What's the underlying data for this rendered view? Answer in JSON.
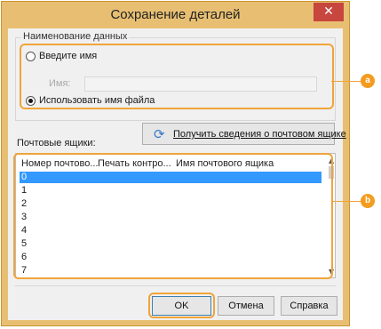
{
  "window": {
    "title": "Сохранение деталей",
    "close_glyph": "✕"
  },
  "data_name_group": {
    "title": "Наименование данных",
    "option_enter_name": "Введите имя",
    "name_label": "Имя:",
    "name_value": "",
    "option_use_filename": "Использовать имя файла",
    "selected_option": "use_filename"
  },
  "mailboxes": {
    "label": "Почтовые ящики:",
    "get_info_button": "Получить сведения о почтовом ящике",
    "columns": [
      "Номер почтово...",
      "Печать контро...",
      "Имя почтового ящика"
    ],
    "rows": [
      "0",
      "1",
      "2",
      "3",
      "4",
      "5",
      "6",
      "7"
    ],
    "selected_row": "0"
  },
  "buttons": {
    "ok": "OK",
    "cancel": "Отмена",
    "help": "Справка"
  },
  "callouts": [
    "a",
    "b"
  ],
  "colors": {
    "highlight": "#f0a43a",
    "callout": "#f39c1f",
    "selection": "#3399ff",
    "close": "#c7463e"
  },
  "icons": {
    "refresh": "refresh-icon",
    "close": "close-icon"
  }
}
